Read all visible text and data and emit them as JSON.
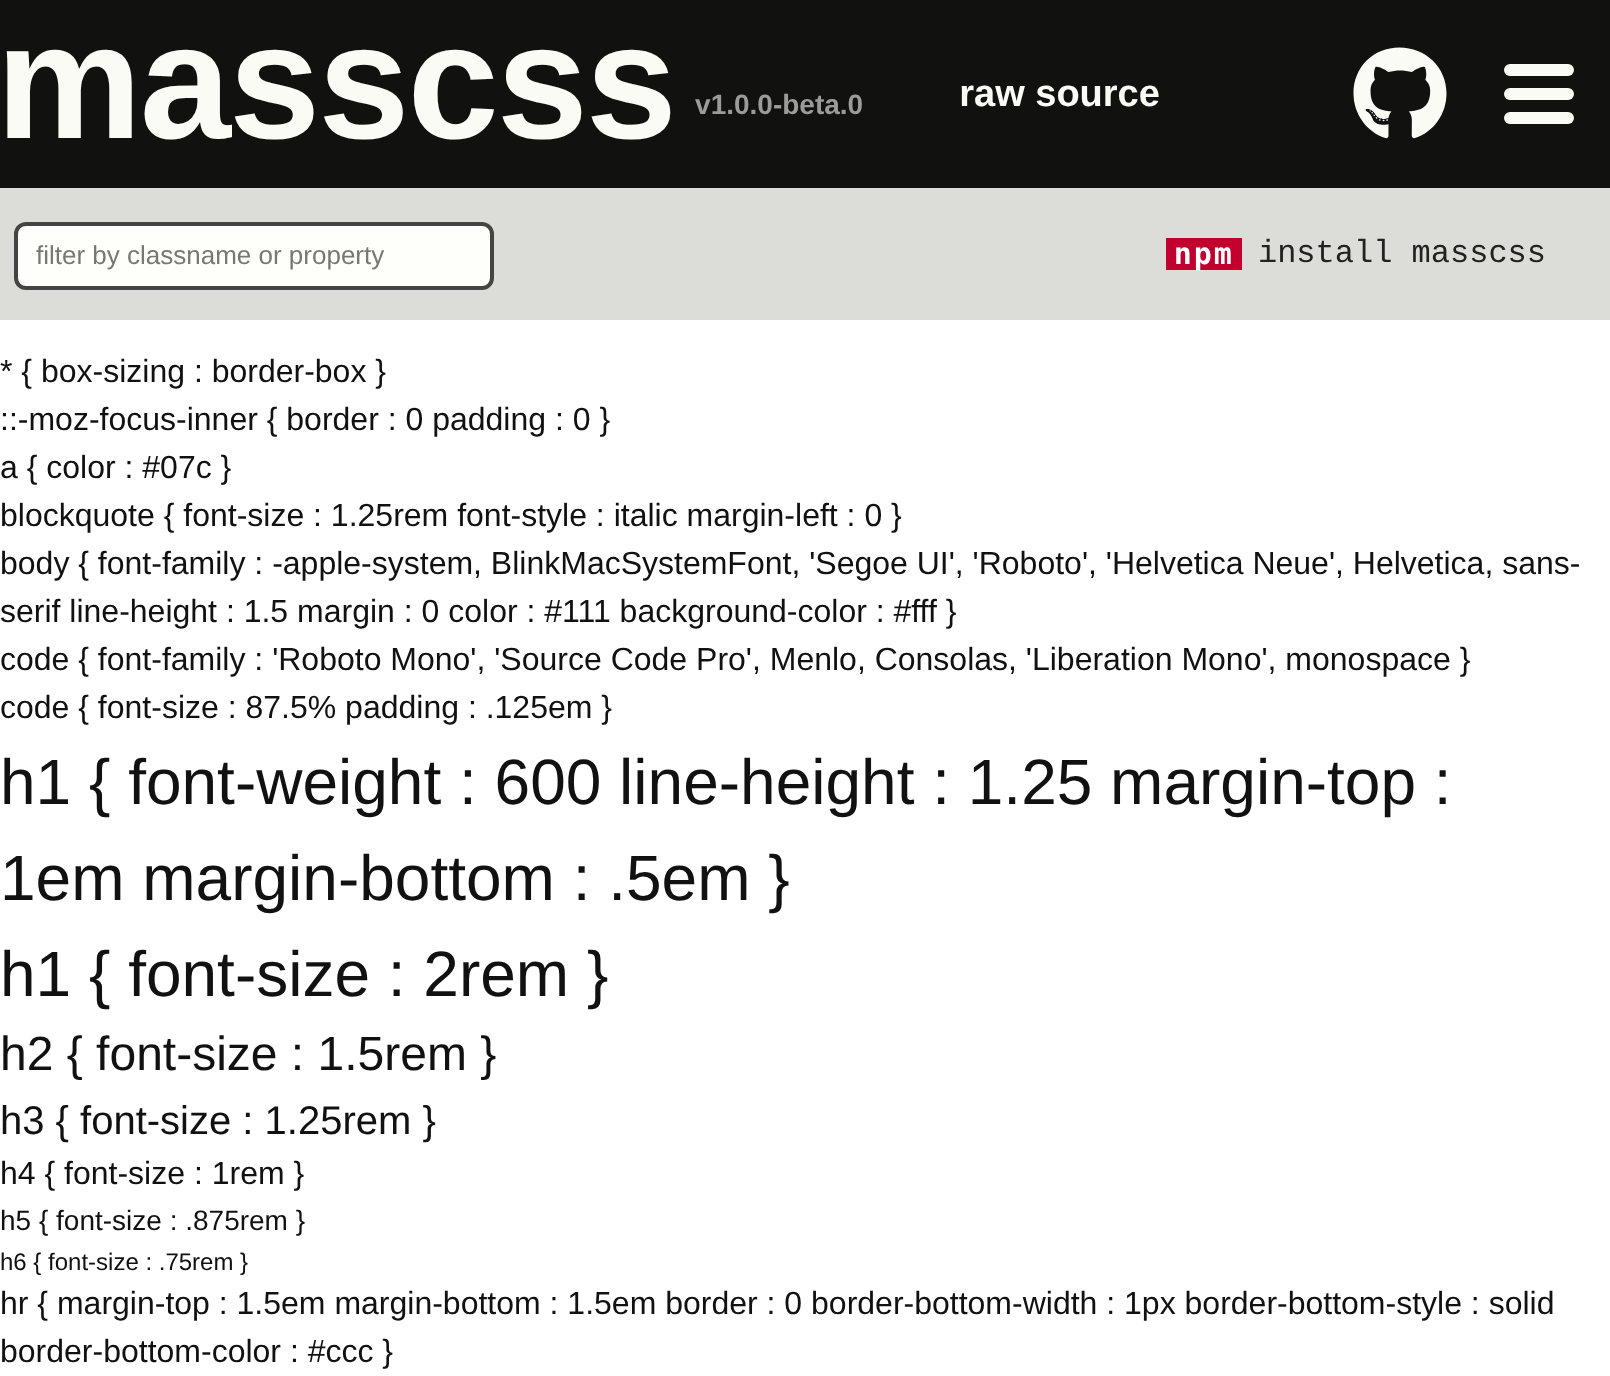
{
  "header": {
    "title": "masscss",
    "version": "v1.0.0-beta.0",
    "raw_source_link": "raw source"
  },
  "toolbar": {
    "filter": {
      "placeholder": "filter by classname or property"
    },
    "npm_logo": "npm",
    "install_command": "install masscss"
  },
  "rules": [
    {
      "kind": "normal",
      "text": "* { box-sizing : border-box }"
    },
    {
      "kind": "normal",
      "text": "::-moz-focus-inner { border : 0 padding : 0 }"
    },
    {
      "kind": "normal",
      "text": "a { color : #07c }"
    },
    {
      "kind": "normal",
      "text": "blockquote { font-size : 1.25rem font-style : italic margin-left : 0 }"
    },
    {
      "kind": "normal",
      "text": "body { font-family : -apple-system, BlinkMacSystemFont, 'Segoe UI', 'Roboto', 'Helvetica Neue', Helvetica, sans-serif line-height : 1.5 margin : 0 color : #111 background-color : #fff }"
    },
    {
      "kind": "normal",
      "text": "code { font-family : 'Roboto Mono', 'Source Code Pro', Menlo, Consolas, 'Liberation Mono', monospace }"
    },
    {
      "kind": "normal",
      "text": "code { font-size : 87.5% padding : .125em }"
    },
    {
      "kind": "h1",
      "text": "h1 { font-weight : 600 line-height : 1.25 margin-top : 1em margin-bottom : .5em }"
    },
    {
      "kind": "h1",
      "text": "h1 { font-size : 2rem }"
    },
    {
      "kind": "h2",
      "text": "h2 { font-size : 1.5rem }"
    },
    {
      "kind": "h3",
      "text": "h3 { font-size : 1.25rem }"
    },
    {
      "kind": "h4",
      "text": "h4 { font-size : 1rem }"
    },
    {
      "kind": "h5",
      "text": "h5 { font-size : .875rem }"
    },
    {
      "kind": "h6",
      "text": "h6 { font-size : .75rem }"
    },
    {
      "kind": "normal",
      "text": "hr { margin-top : 1.5em margin-bottom : 1.5em border : 0 border-bottom-width : 1px border-bottom-style : solid border-bottom-color : #ccc }"
    }
  ]
}
